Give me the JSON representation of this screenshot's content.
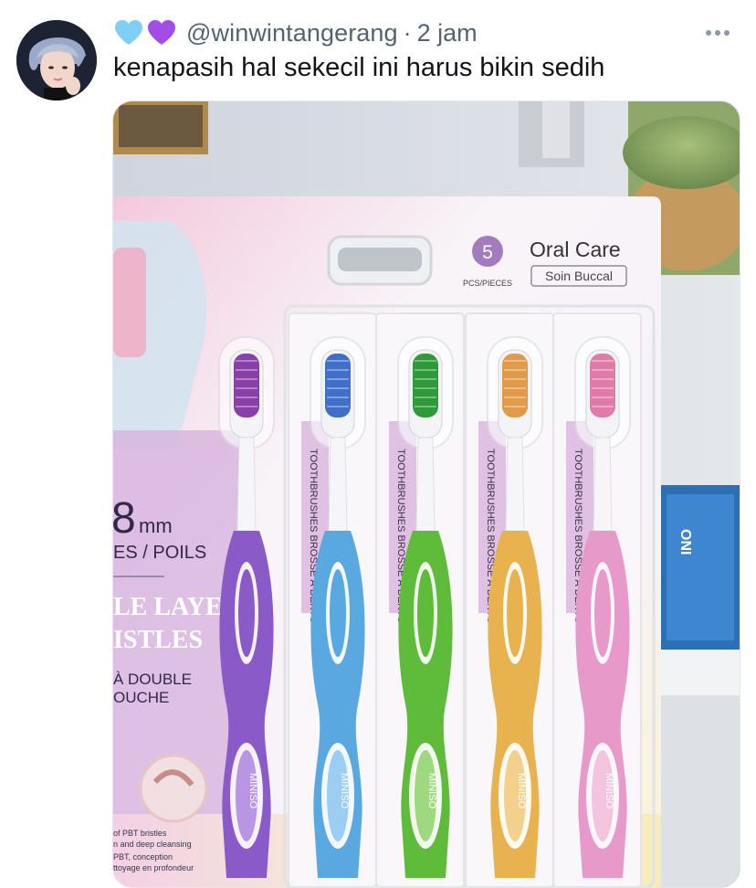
{
  "tweet": {
    "emoji": [
      "light-blue-heart",
      "purple-heart"
    ],
    "handle": "@winwintangerang",
    "separator": "·",
    "time": "2 jam",
    "text": "kenapasih hal sekecil ini harus bikin sedih",
    "more_label": "More"
  },
  "media": {
    "alt": "photo of a pack of toothbrushes",
    "package": {
      "count": "5",
      "count_caption": "PCS/PIECES",
      "title": "Oral Care",
      "subtitle": "Soin Buccal",
      "left_big": "8",
      "left_unit": "mm",
      "left_line1": "ES / POILS",
      "left_line2": "LE LAYER",
      "left_line3": "ISTLES",
      "left_line4": "À DOUBLE",
      "left_line5": "OUCHE",
      "fine1": "of PBT bristles",
      "fine2": "n and deep cleansing",
      "fine3": "PBT, conception",
      "fine4": "ttoyage en profondeur",
      "card_text": "TOOTHBRUSHES BROSSE À DENTS",
      "brand": "MINISO",
      "right_label": "ONI"
    },
    "brushes": [
      {
        "color": "#8a5bc8",
        "head": "#8a3fa8",
        "light": "#b896e3"
      },
      {
        "color": "#5aa8e0",
        "head": "#3f6fc8",
        "light": "#9ccdf2"
      },
      {
        "color": "#5fbb3a",
        "head": "#2f9a3a",
        "light": "#9fd97f"
      },
      {
        "color": "#e8b24f",
        "head": "#e09a4a",
        "light": "#f3d08c"
      },
      {
        "color": "#e79ac9",
        "head": "#e07aa8",
        "light": "#f2c4de"
      }
    ]
  }
}
